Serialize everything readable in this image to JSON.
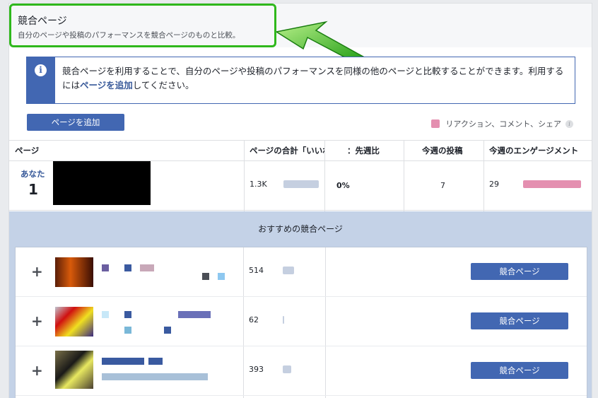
{
  "header": {
    "title": "競合ページ",
    "subtitle": "自分のページや投稿のパフォーマンスを競合ページのものと比較。"
  },
  "notice": {
    "icon": "info-icon",
    "text_before": "競合ページを利用することで、自分のページや投稿のパフォーマンスを同様の他のページと比較することができます。利用するには",
    "link": "ページを追加",
    "text_after": "してください。"
  },
  "toolbar": {
    "add_page_label": "ページを追加",
    "legend_label": "リアクション、コメント、シェア",
    "legend_color": "#e48fb0"
  },
  "table": {
    "headers": [
      "ページ",
      "ページの合計「いいね！」",
      "：先週比",
      "今週の投稿",
      "今週のエンゲージメント"
    ],
    "you": {
      "label": "あなた",
      "rank": "1",
      "total_likes": "1.3K",
      "change": "0%",
      "posts": "7",
      "engagement": "29"
    }
  },
  "recommended": {
    "title": "おすすめの競合ページ",
    "rows": [
      {
        "likes": "514",
        "button": "競合ページ"
      },
      {
        "likes": "62",
        "button": "競合ページ"
      },
      {
        "likes": "393",
        "button": "競合ページ"
      }
    ]
  },
  "colors": {
    "accent": "#4267b2",
    "highlight": "#2fb81c",
    "likes_bar": "#c5cfe0",
    "engagement_bar": "#e48fb0"
  }
}
